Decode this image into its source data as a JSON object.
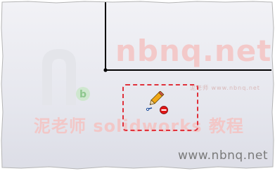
{
  "watermark": {
    "logo_letter": "n",
    "logo_sub_letter": "b",
    "domain_big": "nbnq.net",
    "domain_small": "泥老师 www.nbnq.net",
    "cn_text": "泥老师 solidworks 教程"
  },
  "footer": {
    "url": "www.nbnq.net"
  },
  "cursor": {
    "icon": "sketch-pencil-no-entry-icon"
  },
  "colors": {
    "sketch_line": "#000000",
    "selection_border": "#e0303a",
    "watermark": "#f2c7c7",
    "cursor_pencil": "#f0a818",
    "cursor_no_entry": "#e01818"
  }
}
